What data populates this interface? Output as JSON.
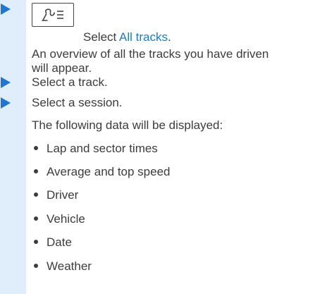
{
  "steps": {
    "step1_prefix": "Select ",
    "step1_link": "All tracks",
    "step1_suffix": ".",
    "step1_result_line1": "An overview of all the tracks you have driven",
    "step1_result_line2": "will appear.",
    "step2": "Select a track.",
    "step3": "Select a session.",
    "data_intro": "The following data will be displayed:"
  },
  "data_items": [
    "Lap and sector times",
    "Average and top speed",
    "Driver",
    "Vehicle",
    "Date",
    "Weather"
  ],
  "icons": {
    "menu_button": "track-menu-icon"
  },
  "colors": {
    "sidebar": "#dfeefa",
    "arrow": "#1e78d2",
    "link": "#1b7fc4",
    "text": "#3c3c3c"
  }
}
